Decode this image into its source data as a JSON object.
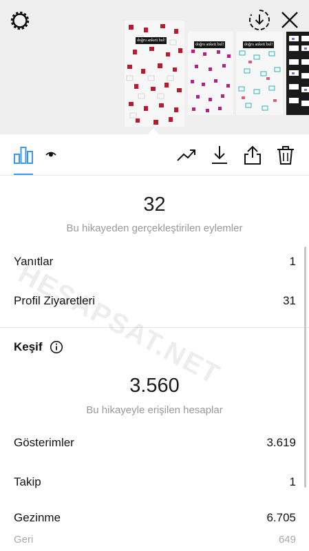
{
  "header": {
    "settings_icon": "gear-icon",
    "download_circle_icon": "download-circle-icon",
    "close_icon": "close-icon"
  },
  "thumbnails": [
    {
      "tag": "doğru anketi bul!",
      "selected": true,
      "sticker_color": "#c0182a"
    },
    {
      "tag": "doğru anketi bul!",
      "selected": false,
      "sticker_color": "#c2188f"
    },
    {
      "tag": "doğru anketi bul!",
      "selected": false,
      "sticker_color": "#2bb3b8"
    },
    {
      "tag": "",
      "selected": false,
      "sticker_color": "#1a1a1a"
    }
  ],
  "toolbar": {
    "insights_icon": "bar-chart-icon",
    "viewers_icon": "eye-icon",
    "promote_icon": "trend-up-icon",
    "save_icon": "download-icon",
    "share_icon": "share-icon",
    "delete_icon": "trash-icon",
    "accent": "#3897f0"
  },
  "actions": {
    "total": "32",
    "caption": "Bu hikayeden gerçekleştirilen eylemler",
    "rows": [
      {
        "label": "Yanıtlar",
        "value": "1"
      },
      {
        "label": "Profil Ziyaretleri",
        "value": "31"
      }
    ]
  },
  "discovery": {
    "title": "Keşif",
    "info_icon": "info-icon",
    "total": "3.560",
    "caption": "Bu hikayeyle erişilen hesaplar",
    "rows": [
      {
        "label": "Gösterimler",
        "value": "3.619"
      },
      {
        "label": "Takip",
        "value": "1"
      },
      {
        "label": "Gezinme",
        "value": "6.705"
      },
      {
        "label": "Geri",
        "value": "649"
      }
    ]
  },
  "watermark": "HESAPSAT.NET"
}
